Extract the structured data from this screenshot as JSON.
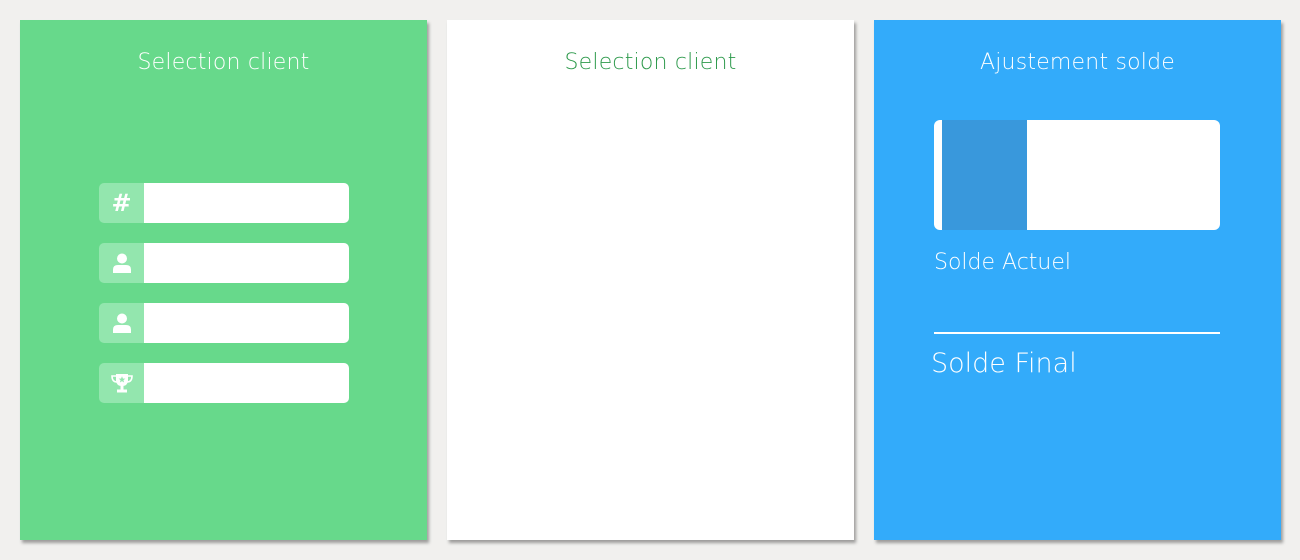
{
  "cards": [
    {
      "title": "Selection client",
      "background": "#67d98b",
      "fields": [
        {
          "icon": "hash-icon",
          "glyph": "#",
          "value": ""
        },
        {
          "icon": "user-icon",
          "value": ""
        },
        {
          "icon": "user-icon",
          "value": ""
        },
        {
          "icon": "trophy-icon",
          "value": ""
        }
      ]
    },
    {
      "title": "Selection client",
      "background": "#ffffff",
      "title_color": "#2e9a4c"
    },
    {
      "title": "Ajustement solde",
      "background": "#33abfa",
      "balance_value": "",
      "solde_actuel_label": "Solde Actuel",
      "solde_final_label": "Solde Final"
    }
  ],
  "colors": {
    "page_background": "#f1f0ee",
    "field_icon_background": "#93e6ae",
    "balance_accent": "#3998dc"
  }
}
